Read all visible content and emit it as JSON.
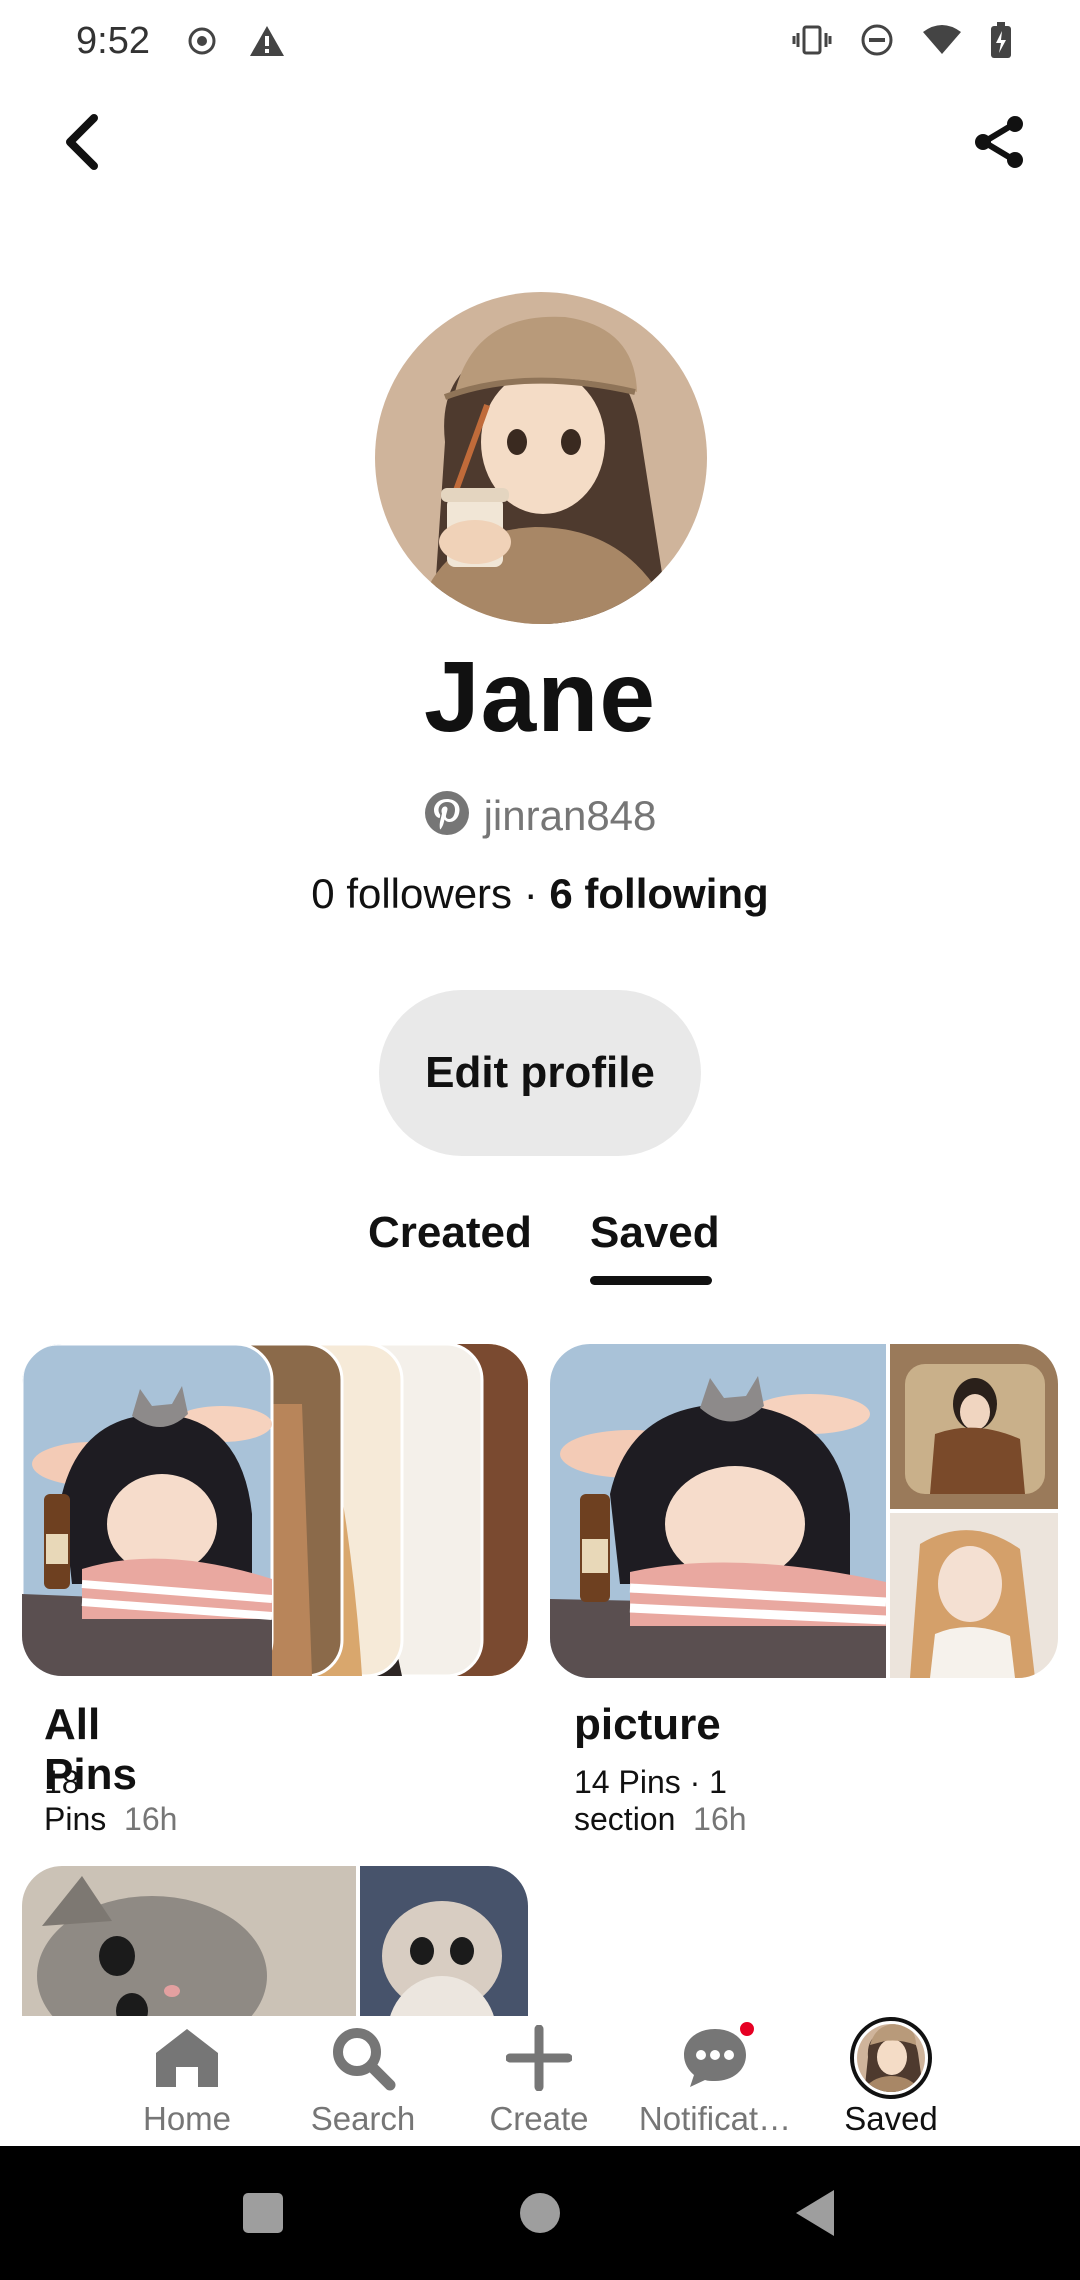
{
  "status_bar": {
    "time": "9:52"
  },
  "top_bar": {
    "back_icon": "chevron-left-icon",
    "share_icon": "share-icon"
  },
  "profile": {
    "name": "Jane",
    "username": "jinran848",
    "followers_label": "0 followers",
    "separator": " · ",
    "following_label": "6 following",
    "edit_button": "Edit profile"
  },
  "tabs": {
    "created": "Created",
    "saved": "Saved",
    "active": "saved"
  },
  "boards": [
    {
      "title": "All Pins",
      "pins": "18 Pins",
      "sections": "",
      "age": "16h"
    },
    {
      "title": "picture",
      "pins": "14 Pins · 1 section",
      "sections": "",
      "age": "16h"
    }
  ],
  "nav": {
    "home": "Home",
    "search": "Search",
    "create": "Create",
    "notifications": "Notificat…",
    "saved": "Saved",
    "active": "saved"
  },
  "colors": {
    "brand_red": "#e60023",
    "muted_text": "#767676",
    "button_gray": "#e9e9e9"
  }
}
